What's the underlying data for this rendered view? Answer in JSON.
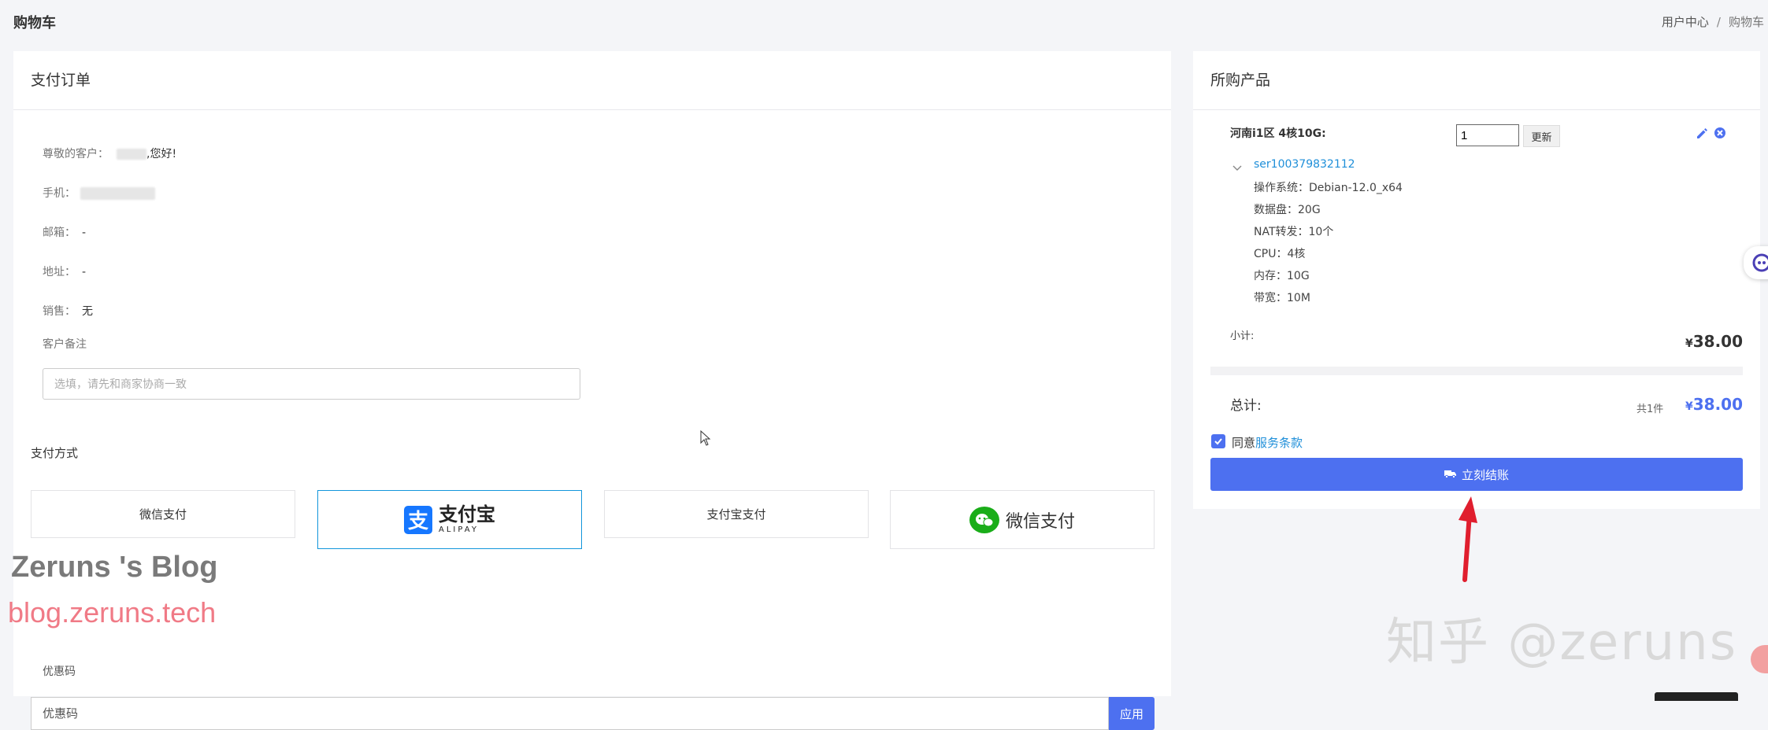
{
  "page": {
    "title": "购物车",
    "breadcrumb": [
      "用户中心",
      "购物车"
    ]
  },
  "order": {
    "header": "支付订单",
    "greeting_label": "尊敬的客户：",
    "greeting_suffix": ",您好!",
    "phone_label": "手机：",
    "email_label": "邮箱：",
    "email_value": "-",
    "address_label": "地址：",
    "address_value": "-",
    "sales_label": "销售：",
    "sales_value": "无",
    "note_label": "客户备注",
    "note_placeholder": "选填，请先和商家协商一致",
    "payment_label": "支付方式",
    "payment_options": [
      {
        "label": "微信支付"
      },
      {
        "logo_cn": "支付宝",
        "logo_en": "ALIPAY",
        "selected": true
      },
      {
        "label": "支付宝支付"
      },
      {
        "logo_cn": "微信支付"
      }
    ],
    "coupon_label": "优惠码",
    "coupon_placeholder": "优惠码",
    "coupon_button": "应用"
  },
  "cart": {
    "header": "所购产品",
    "product_name": "河南i1区 4核10G:",
    "quantity": "1",
    "update_button": "更新",
    "server_id": "ser100379832112",
    "specs": [
      "操作系统：Debian-12.0_x64",
      "数据盘：20G",
      "NAT转发：10个",
      "CPU：4核",
      "内存：10G",
      "带宽：10M"
    ],
    "subtotal_label": "小计:",
    "currency": "¥",
    "subtotal_value": "38.00",
    "total_label": "总计:",
    "total_count": "共1件",
    "total_value": "38.00",
    "agree_prefix": "同意",
    "agree_link": "服务条款",
    "checkout_button": "立刻结账"
  },
  "watermarks": {
    "blog_name": "Zeruns 's Blog",
    "blog_url": "blog.zeruns.tech",
    "zhihu": "知乎 @zeruns"
  },
  "colors": {
    "primary": "#4d70f0",
    "link": "#1f8fd9",
    "alipay_border": "#1296db",
    "annotation_arrow": "#e01e2e"
  }
}
